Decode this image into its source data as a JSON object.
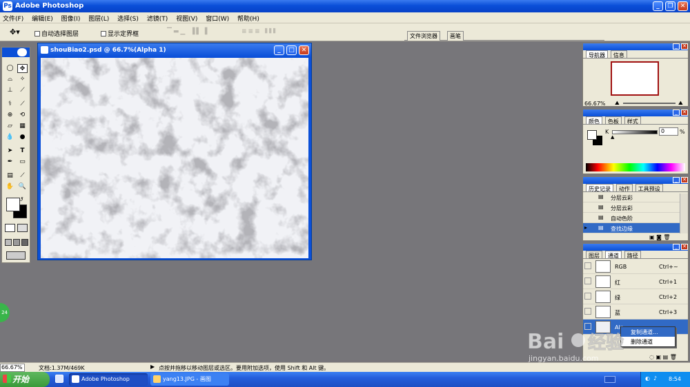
{
  "app": {
    "title": "Adobe Photoshop"
  },
  "menu": [
    "文件(F)",
    "编辑(E)",
    "图像(I)",
    "图层(L)",
    "选择(S)",
    "滤镜(T)",
    "视图(V)",
    "窗口(W)",
    "帮助(H)"
  ],
  "options": {
    "auto_select": "自动选择图层",
    "show_bounds": "显示定界框",
    "file_browser": "文件浏览器",
    "brushes": "画笔"
  },
  "document": {
    "title": "shouBiao2.psd @ 66.7%(Alpha 1)"
  },
  "navigator": {
    "tabs": [
      "导航器",
      "信息"
    ],
    "zoom": "66.67%"
  },
  "color": {
    "tabs": [
      "颜色",
      "色板",
      "样式"
    ],
    "k_label": "K",
    "k_value": "0",
    "k_unit": "%"
  },
  "history": {
    "tabs": [
      "历史记录",
      "动作",
      "工具预设"
    ],
    "items": [
      "分层云彩",
      "分层云彩",
      "自动色阶",
      "查找边缘"
    ]
  },
  "channels": {
    "tabs": [
      "图层",
      "通道",
      "路径"
    ],
    "rows": [
      {
        "name": "RGB",
        "shortcut": "Ctrl+~"
      },
      {
        "name": "红",
        "shortcut": "Ctrl+1"
      },
      {
        "name": "绿",
        "shortcut": "Ctrl+2"
      },
      {
        "name": "蓝",
        "shortcut": "Ctrl+3"
      },
      {
        "name": "Alp",
        "shortcut": ""
      }
    ],
    "context_menu": [
      "复制通道...",
      "删除通道"
    ]
  },
  "status": {
    "zoom": "66.67%",
    "doc": "文档:1.37M/469K",
    "hint": "点按并拖移以移动图层或选区。要用附加选项，使用 Shift 和 Alt 键。"
  },
  "taskbar": {
    "start": "开始",
    "tasks": [
      "Adobe Photoshop",
      "yang13.JPG - 画图"
    ],
    "time": "8:54",
    "badge": "24"
  },
  "watermark": {
    "logo": "Baidu经验",
    "url": "jingyan.baidu.com"
  },
  "colors": {
    "accent": "#0a4fd8",
    "selection": "#316ac5"
  }
}
